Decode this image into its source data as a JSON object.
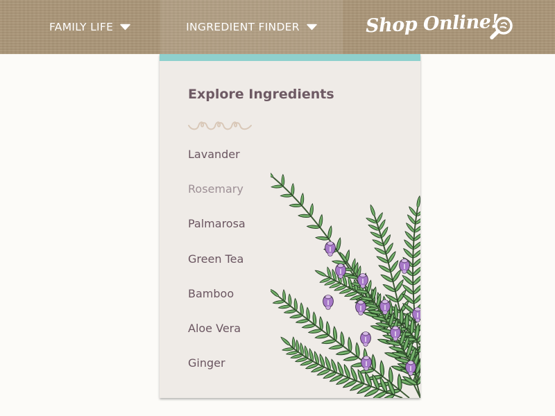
{
  "nav": {
    "items": [
      {
        "label": "FAMILY LIFE",
        "icon": "chevron-down-icon"
      },
      {
        "label": "INGREDIENT FINDER",
        "icon": "chevron-down-icon",
        "open": true
      }
    ],
    "shop_label": "Shop Online!",
    "search_icon": "search-icon"
  },
  "dropdown": {
    "title": "Explore Ingredients",
    "ingredients": [
      "Lavander",
      "Rosemary",
      "Palmarosa",
      "Green Tea",
      "Bamboo",
      "Aloe Vera",
      "Ginger"
    ],
    "active_ingredient": "Rosemary",
    "illustration": "rosemary-illustration"
  },
  "colors": {
    "header_bg": "#aa9678",
    "accent_bar": "#8fd0cd",
    "panel_bg": "#efebe7",
    "text": "#6a5560",
    "text_muted": "#9d8f95",
    "page_bg": "#fcfbf8"
  }
}
